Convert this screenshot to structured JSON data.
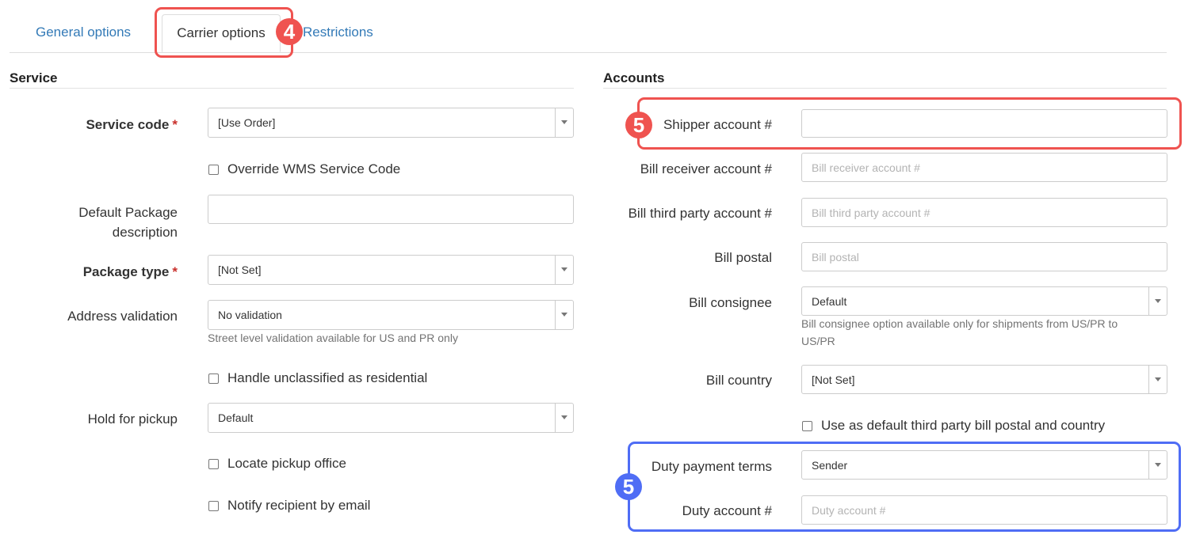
{
  "tabs": {
    "general": "General options",
    "carrier": "Carrier options",
    "restrictions": "Restrictions"
  },
  "service": {
    "title": "Service",
    "service_code_label": "Service code",
    "service_code_value": "[Use Order]",
    "override_label": "Override WMS Service Code",
    "default_package_label_line1": "Default Package",
    "default_package_label_line2": "description",
    "default_package_value": "",
    "package_type_label": "Package type",
    "package_type_value": "[Not Set]",
    "address_validation_label": "Address validation",
    "address_validation_value": "No validation",
    "address_validation_help": "Street level validation available for US and PR only",
    "handle_unclassified_label": "Handle unclassified as residential",
    "hold_for_pickup_label": "Hold for pickup",
    "hold_for_pickup_value": "Default",
    "locate_pickup_label": "Locate pickup office",
    "notify_recipient_label": "Notify recipient by email",
    "required_mark": "*"
  },
  "accounts": {
    "title": "Accounts",
    "shipper_label": "Shipper account #",
    "shipper_value": "",
    "bill_receiver_label": "Bill receiver account #",
    "bill_receiver_placeholder": "Bill receiver account #",
    "bill_third_party_label": "Bill third party account #",
    "bill_third_party_placeholder": "Bill third party account #",
    "bill_postal_label": "Bill postal",
    "bill_postal_placeholder": "Bill postal",
    "bill_consignee_label": "Bill consignee",
    "bill_consignee_value": "Default",
    "bill_consignee_help_line1": "Bill consignee option available only for shipments from US/PR to",
    "bill_consignee_help_line2": "US/PR",
    "bill_country_label": "Bill country",
    "bill_country_value": "[Not Set]",
    "use_default_label": "Use as default third party bill postal and country",
    "duty_terms_label": "Duty payment terms",
    "duty_terms_value": "Sender",
    "duty_account_label": "Duty account #",
    "duty_account_placeholder": "Duty account #"
  },
  "annotations": {
    "badge_tab": "4",
    "badge_shipper": "5",
    "badge_duty": "5"
  },
  "colors": {
    "link": "#337ab7",
    "highlight_red": "#ef5350",
    "highlight_blue": "#4f6df5",
    "required": "#c9302c"
  }
}
